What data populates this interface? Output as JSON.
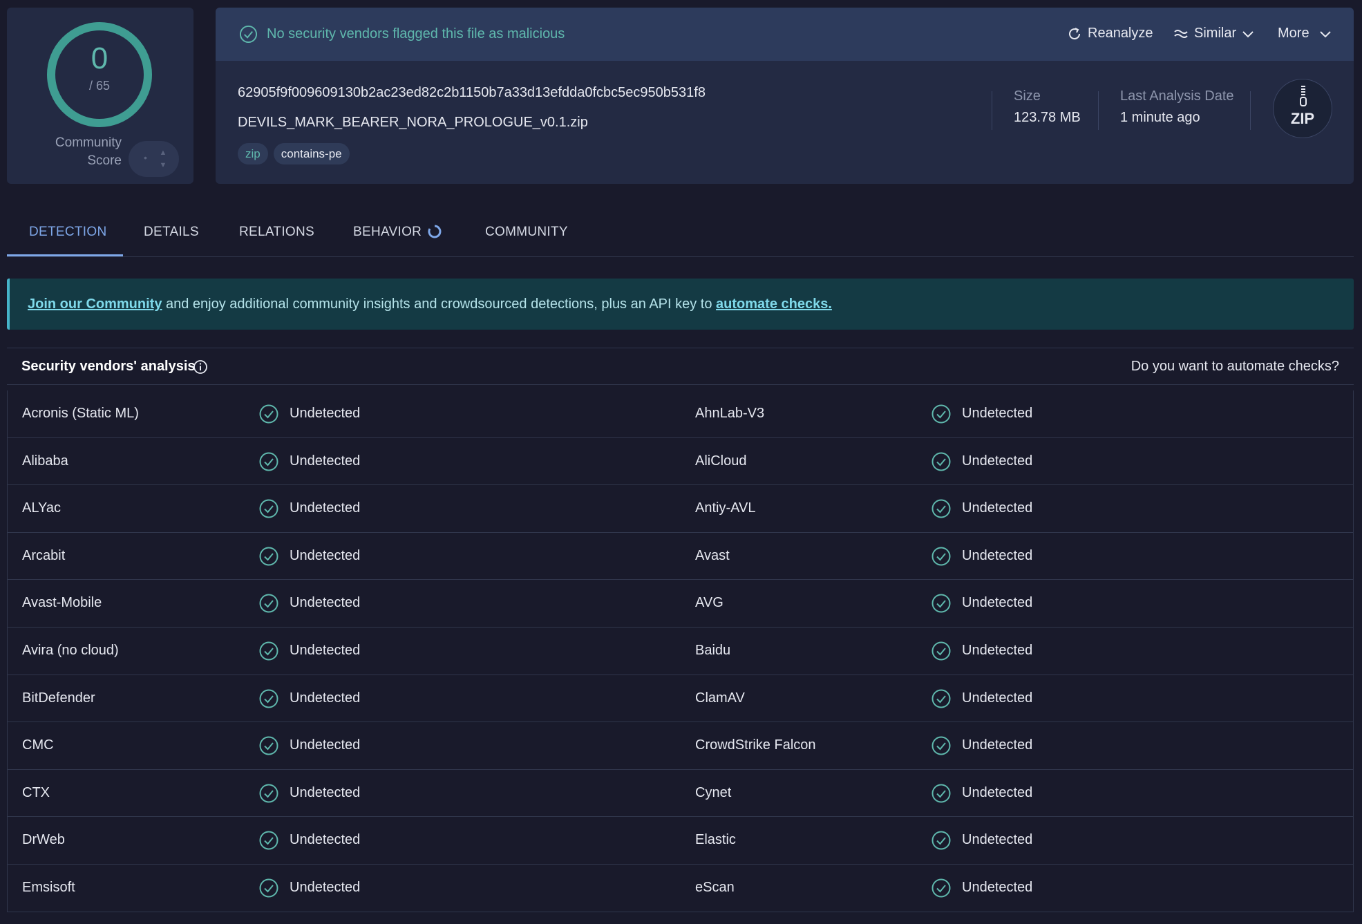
{
  "score": {
    "detections": "0",
    "total": "/ 65",
    "community_label_line1": "Community",
    "community_label_line2": "Score",
    "vote_dot": "•",
    "accent_color": "#3f9d92"
  },
  "status": {
    "message": "No security vendors flagged this file as malicious",
    "actions": {
      "reanalyze": "Reanalyze",
      "similar": "Similar",
      "more": "More"
    }
  },
  "file": {
    "hash": "62905f9f009609130b2ac23ed82c2b1150b7a33d13efdda0fcbc5ec950b531f8",
    "name": "DEVILS_MARK_BEARER_NORA_PROLOGUE_v0.1.zip",
    "tags": [
      "zip",
      "contains-pe"
    ],
    "size_label": "Size",
    "size_value": "123.78 MB",
    "date_label": "Last Analysis Date",
    "date_value": "1 minute ago",
    "type_badge": "ZIP"
  },
  "tabs": [
    {
      "label": "DETECTION",
      "active": true
    },
    {
      "label": "DETAILS",
      "active": false
    },
    {
      "label": "RELATIONS",
      "active": false
    },
    {
      "label": "BEHAVIOR",
      "active": false
    },
    {
      "label": "COMMUNITY",
      "active": false
    }
  ],
  "banner": {
    "link1": "Join our Community",
    "middle": " and enjoy additional community insights and crowdsourced detections, plus an API key to ",
    "link2": "automate checks."
  },
  "vendors": {
    "title": "Security vendors' analysis",
    "automate_prompt": "Do you want to automate checks?",
    "rows": [
      [
        {
          "vendor": "Acronis (Static ML)",
          "result": "Undetected"
        },
        {
          "vendor": "AhnLab-V3",
          "result": "Undetected"
        }
      ],
      [
        {
          "vendor": "Alibaba",
          "result": "Undetected"
        },
        {
          "vendor": "AliCloud",
          "result": "Undetected"
        }
      ],
      [
        {
          "vendor": "ALYac",
          "result": "Undetected"
        },
        {
          "vendor": "Antiy-AVL",
          "result": "Undetected"
        }
      ],
      [
        {
          "vendor": "Arcabit",
          "result": "Undetected"
        },
        {
          "vendor": "Avast",
          "result": "Undetected"
        }
      ],
      [
        {
          "vendor": "Avast-Mobile",
          "result": "Undetected"
        },
        {
          "vendor": "AVG",
          "result": "Undetected"
        }
      ],
      [
        {
          "vendor": "Avira (no cloud)",
          "result": "Undetected"
        },
        {
          "vendor": "Baidu",
          "result": "Undetected"
        }
      ],
      [
        {
          "vendor": "BitDefender",
          "result": "Undetected"
        },
        {
          "vendor": "ClamAV",
          "result": "Undetected"
        }
      ],
      [
        {
          "vendor": "CMC",
          "result": "Undetected"
        },
        {
          "vendor": "CrowdStrike Falcon",
          "result": "Undetected"
        }
      ],
      [
        {
          "vendor": "CTX",
          "result": "Undetected"
        },
        {
          "vendor": "Cynet",
          "result": "Undetected"
        }
      ],
      [
        {
          "vendor": "DrWeb",
          "result": "Undetected"
        },
        {
          "vendor": "Elastic",
          "result": "Undetected"
        }
      ],
      [
        {
          "vendor": "Emsisoft",
          "result": "Undetected"
        },
        {
          "vendor": "eScan",
          "result": "Undetected"
        }
      ]
    ]
  }
}
